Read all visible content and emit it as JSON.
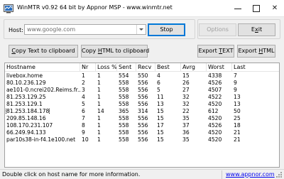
{
  "window": {
    "title": "WinMTR v0.92 64 bit by Appnor MSP - www.winmtr.net",
    "minimize_symbol": "",
    "close_symbol": "✕"
  },
  "host": {
    "label": "Host:",
    "value": "www.google.com"
  },
  "buttons": {
    "stop": "Stop",
    "options": "Options",
    "exit_prefix": "E",
    "exit_underlined": "x",
    "exit_suffix": "it",
    "copy_text_prefix": "",
    "copy_text_underlined": "C",
    "copy_text_suffix": "opy Text to clipboard",
    "copy_html_prefix": "Copy ",
    "copy_html_underlined": "H",
    "copy_html_suffix": "TML to clipboard",
    "export_text_prefix": "Export ",
    "export_text_underlined": "T",
    "export_text_suffix": "EXT",
    "export_html_prefix": "Export ",
    "export_html_underlined": "H",
    "export_html_suffix": "TML"
  },
  "table": {
    "columns": [
      "Hostname",
      "Nr",
      "Loss %",
      "Sent",
      "Recv",
      "Best",
      "Avrg",
      "Worst",
      "Last"
    ],
    "rows": [
      [
        "livebox.home",
        "1",
        "1",
        "554",
        "550",
        "4",
        "15",
        "4338",
        "7"
      ],
      [
        "80.10.236.129",
        "2",
        "1",
        "558",
        "556",
        "6",
        "26",
        "4526",
        "9"
      ],
      [
        "ae101-0.ncrei202.Reims.fr...",
        "3",
        "1",
        "558",
        "556",
        "5",
        "27",
        "4507",
        "9"
      ],
      [
        "81.253.129.25",
        "4",
        "1",
        "558",
        "556",
        "11",
        "32",
        "4522",
        "13"
      ],
      [
        "81.253.129.1",
        "5",
        "1",
        "558",
        "556",
        "13",
        "32",
        "4520",
        "13"
      ],
      [
        "81.253.184.178",
        "6",
        "14",
        "365",
        "314",
        "15",
        "22",
        "612",
        "50"
      ],
      [
        "209.85.148.16",
        "7",
        "1",
        "558",
        "556",
        "15",
        "35",
        "4520",
        "25"
      ],
      [
        "108.170.231.107",
        "8",
        "1",
        "558",
        "556",
        "17",
        "37",
        "4526",
        "18"
      ],
      [
        "66.249.94.133",
        "9",
        "1",
        "558",
        "556",
        "15",
        "36",
        "4520",
        "21"
      ],
      [
        "par10s38-in-f4.1e100.net",
        "10",
        "1",
        "558",
        "556",
        "15",
        "35",
        "4520",
        "21"
      ]
    ],
    "selected_row": 5
  },
  "status": {
    "message": "Double click on host name for more information.",
    "link": "www.appnor.com"
  }
}
